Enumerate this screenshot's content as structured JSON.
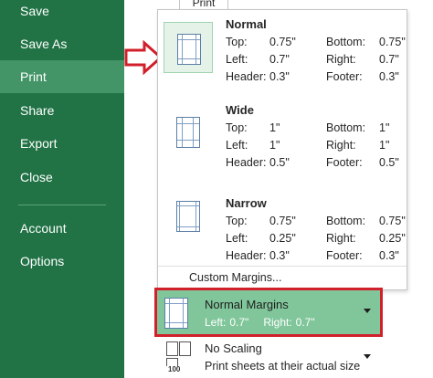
{
  "sidebar": {
    "items": [
      {
        "label": "Save"
      },
      {
        "label": "Save As"
      },
      {
        "label": "Print"
      },
      {
        "label": "Share"
      },
      {
        "label": "Export"
      },
      {
        "label": "Close"
      },
      {
        "label": "Account"
      },
      {
        "label": "Options"
      }
    ],
    "active_index": 2,
    "colors": {
      "background": "#217346",
      "active": "#439467"
    }
  },
  "print_button": {
    "label": "Print"
  },
  "margins_menu": {
    "presets": [
      {
        "name": "Normal",
        "top_label": "Top:",
        "top": "0.75\"",
        "bottom_label": "Bottom:",
        "bottom": "0.75\"",
        "left_label": "Left:",
        "left": "0.7\"",
        "right_label": "Right:",
        "right": "0.7\"",
        "header_label": "Header:",
        "header": "0.3\"",
        "footer_label": "Footer:",
        "footer": "0.3\"",
        "selected": true
      },
      {
        "name": "Wide",
        "top_label": "Top:",
        "top": "1\"",
        "bottom_label": "Bottom:",
        "bottom": "1\"",
        "left_label": "Left:",
        "left": "1\"",
        "right_label": "Right:",
        "right": "1\"",
        "header_label": "Header:",
        "header": "0.5\"",
        "footer_label": "Footer:",
        "footer": "0.5\"",
        "selected": false
      },
      {
        "name": "Narrow",
        "top_label": "Top:",
        "top": "0.75\"",
        "bottom_label": "Bottom:",
        "bottom": "0.75\"",
        "left_label": "Left:",
        "left": "0.25\"",
        "right_label": "Right:",
        "right": "0.25\"",
        "header_label": "Header:",
        "header": "0.3\"",
        "footer_label": "Footer:",
        "footer": "0.3\"",
        "selected": false
      }
    ],
    "custom_margins_label": "Custom Margins..."
  },
  "margins_combo": {
    "title": "Normal Margins",
    "left_label": "Left:",
    "left_value": "0.7\"",
    "right_label": "Right:",
    "right_value": "0.7\"",
    "highlight_color": "#80c69a",
    "annotation_color": "#d1202a"
  },
  "scaling_combo": {
    "title": "No Scaling",
    "subtitle": "Print sheets at their actual size",
    "icon_text": "100"
  }
}
